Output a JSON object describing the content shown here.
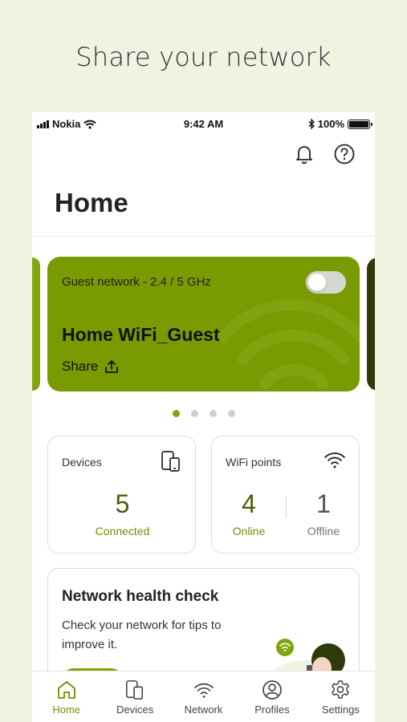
{
  "headline": "Share your network",
  "statusbar": {
    "carrier": "Nokia",
    "time": "9:42 AM",
    "battery": "100%"
  },
  "header": {
    "title": "Home",
    "icons": [
      "bell-icon",
      "help-icon"
    ]
  },
  "carousel": {
    "card": {
      "network_label": "Guest network - 2.4 / 5 GHz",
      "ssid": "Home WiFi_Guest",
      "share_label": "Share",
      "toggle_on": false,
      "color": "#7a9a01"
    },
    "page_count": 4,
    "active_page": 1
  },
  "devices": {
    "label": "Devices",
    "count": "5",
    "status": "Connected"
  },
  "wifi_points": {
    "label": "WiFi points",
    "online_count": "4",
    "online_label": "Online",
    "offline_count": "1",
    "offline_label": "Offline"
  },
  "health": {
    "title": "Network health check",
    "description": "Check your network for tips to improve it."
  },
  "tabs": [
    {
      "label": "Home",
      "icon": "home-icon",
      "active": true
    },
    {
      "label": "Devices",
      "icon": "devices-icon",
      "active": false
    },
    {
      "label": "Network",
      "icon": "wifi-icon",
      "active": false
    },
    {
      "label": "Profiles",
      "icon": "profile-icon",
      "active": false
    },
    {
      "label": "Settings",
      "icon": "gear-icon",
      "active": false
    }
  ],
  "colors": {
    "accent": "#7fa60e",
    "accent_text": "#6f8f05",
    "background": "#eef3e2",
    "dark_green": "#4a5e00"
  }
}
